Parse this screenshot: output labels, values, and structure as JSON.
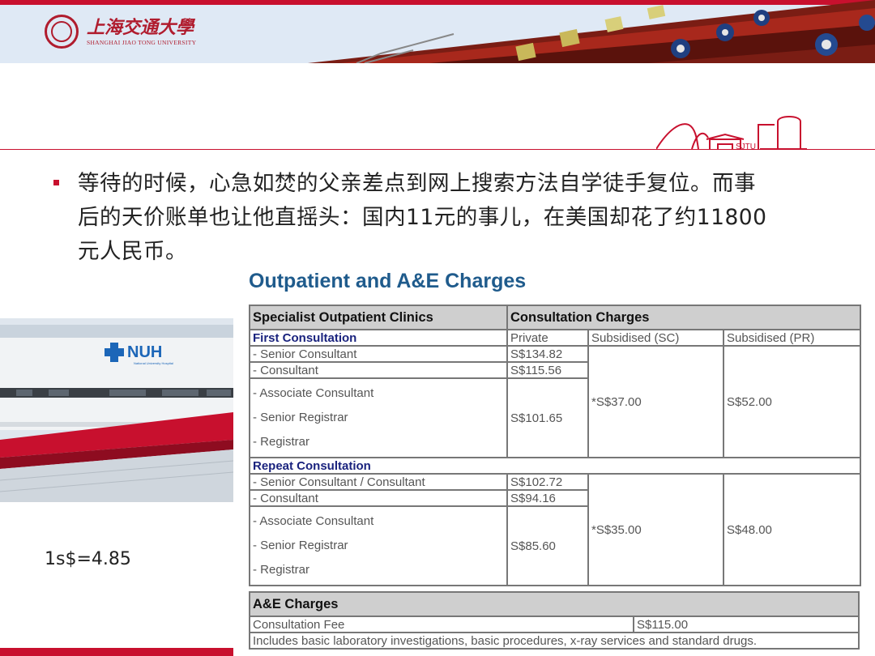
{
  "header": {
    "logo_cn": "上海交通大學",
    "logo_en": "SHANGHAI JIAO TONG UNIVERSITY"
  },
  "bullet": {
    "lines": [
      "等待的时候，心急如焚的父亲差点到网上搜索方法自学徒手复位。而事",
      "后的天价账单也让他直摇头：国内11元的事儿，在美国却花了约11800",
      "元人民币。"
    ]
  },
  "table": {
    "title": "Outpatient and A&E Charges",
    "header_left": "Specialist Outpatient Clinics",
    "header_right": "Consultation Charges",
    "subheaders": [
      "Private",
      "Subsidised (SC)",
      "Subsidised (PR)"
    ],
    "first": {
      "label": "First Consultation",
      "senior_consultant": "- Senior Consultant",
      "senior_consultant_price": "S$134.82",
      "consultant": "- Consultant",
      "consultant_price": "S$115.56",
      "associate": "- Associate Consultant",
      "senior_registrar": "- Senior Registrar",
      "registrar": "- Registrar",
      "group_price": "S$101.65",
      "sc": "*S$37.00",
      "pr": "S$52.00"
    },
    "repeat": {
      "label": "Repeat Consultation",
      "senior_consultant": "- Senior Consultant / Consultant",
      "senior_consultant_price": "S$102.72",
      "consultant": "- Consultant",
      "consultant_price": "S$94.16",
      "associate": "- Associate Consultant",
      "senior_registrar": "- Senior Registrar",
      "registrar": "- Registrar",
      "group_price": "S$85.60",
      "sc": "*S$35.00",
      "pr": "S$48.00"
    },
    "ae": {
      "header": "A&E Charges",
      "fee_label": "Consultation Fee",
      "fee_price": "S$115.00",
      "note": "Includes basic laboratory investigations, basic procedures, x-ray services and standard drugs."
    }
  },
  "photo": {
    "sign": "NUH",
    "sign_sub": "National University Hospital"
  },
  "exchange_rate": "1s$=4.85",
  "colors": {
    "brand_red": "#c8102e",
    "title_blue": "#1f5b8c",
    "section_navy": "#1a237e"
  }
}
